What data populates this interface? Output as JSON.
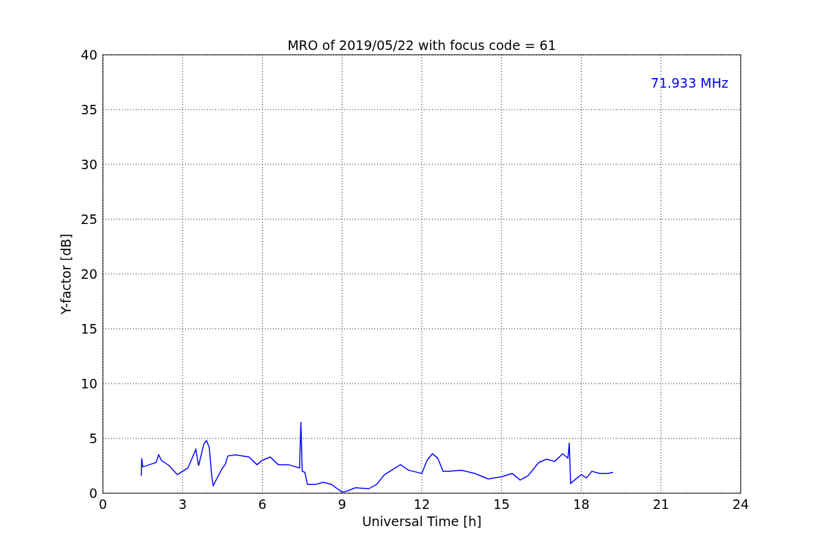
{
  "chart_data": {
    "type": "line",
    "title": "MRO of 2019/05/22 with focus code = 61",
    "xlabel": "Universal Time [h]",
    "ylabel": "Y-factor [dB]",
    "x": [
      1.45,
      1.46,
      1.5,
      2.0,
      2.1,
      2.2,
      2.5,
      2.8,
      3.0,
      3.2,
      3.5,
      3.6,
      3.8,
      3.9,
      4.0,
      4.1,
      4.15,
      4.5,
      4.6,
      4.7,
      5.0,
      5.5,
      5.8,
      6.0,
      6.3,
      6.6,
      7.0,
      7.4,
      7.45,
      7.5,
      7.6,
      7.7,
      8.0,
      8.3,
      8.6,
      9.0,
      9.2,
      9.5,
      10.0,
      10.3,
      10.6,
      11.0,
      11.2,
      11.5,
      12.0,
      12.2,
      12.4,
      12.6,
      12.8,
      13.0,
      13.5,
      14.0,
      14.3,
      14.5,
      15.0,
      15.4,
      15.7,
      16.0,
      16.4,
      16.7,
      17.0,
      17.3,
      17.5,
      17.55,
      17.6,
      17.8,
      18.0,
      18.2,
      18.4,
      18.7,
      19.0,
      19.2
    ],
    "series": [
      {
        "color": "#0000ff",
        "values": [
          1.6,
          3.2,
          2.4,
          2.8,
          3.5,
          3.0,
          2.5,
          1.7,
          2.0,
          2.3,
          4.0,
          2.5,
          4.5,
          4.8,
          4.2,
          1.5,
          0.7,
          2.3,
          2.6,
          3.4,
          3.5,
          3.3,
          2.6,
          3.0,
          3.3,
          2.6,
          2.6,
          2.3,
          6.5,
          2.0,
          1.9,
          0.8,
          0.8,
          1.0,
          0.8,
          0.1,
          0.2,
          0.5,
          0.4,
          0.8,
          1.7,
          2.3,
          2.6,
          2.1,
          1.8,
          3.0,
          3.6,
          3.2,
          2.0,
          2.0,
          2.1,
          1.8,
          1.5,
          1.3,
          1.5,
          1.8,
          1.2,
          1.6,
          2.8,
          3.1,
          2.9,
          3.6,
          3.2,
          4.6,
          0.9,
          1.3,
          1.7,
          1.4,
          2.0,
          1.8,
          1.8,
          1.9
        ]
      }
    ],
    "xlim": [
      0,
      24
    ],
    "ylim": [
      0,
      40
    ],
    "xticks": [
      0,
      3,
      6,
      9,
      12,
      15,
      18,
      21,
      24
    ],
    "yticks": [
      0,
      5,
      10,
      15,
      20,
      25,
      30,
      35,
      40
    ],
    "grid": true,
    "annotations": [
      "71.933 MHz"
    ]
  }
}
